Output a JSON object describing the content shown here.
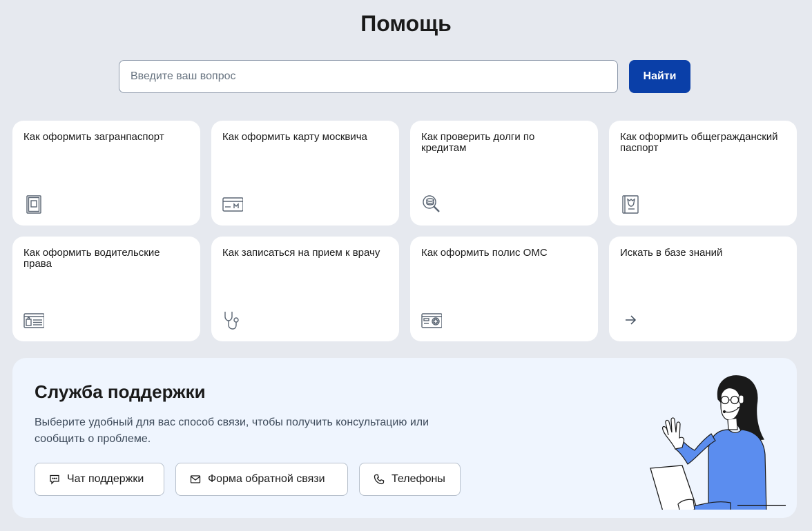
{
  "header": {
    "title": "Помощь"
  },
  "search": {
    "placeholder": "Введите ваш вопрос",
    "button_label": "Найти"
  },
  "cards": [
    {
      "title": "Как оформить загранпаспорт",
      "icon": "passport-icon"
    },
    {
      "title": "Как оформить карту москвича",
      "icon": "card-icon"
    },
    {
      "title": "Как проверить долги по кредитам",
      "icon": "magnifier-coin-icon"
    },
    {
      "title": "Как оформить общегражданский паспорт",
      "icon": "national-passport-icon"
    },
    {
      "title": "Как оформить водительские права",
      "icon": "driver-license-icon"
    },
    {
      "title": "Как записаться на прием к врачу",
      "icon": "stethoscope-icon"
    },
    {
      "title": "Как оформить полис ОМС",
      "icon": "medical-card-icon"
    },
    {
      "title": "Искать в базе знаний",
      "icon": "arrow-right-icon"
    }
  ],
  "support": {
    "title": "Служба поддержки",
    "description": "Выберите удобный для вас способ связи, чтобы получить консультацию или сообщить о проблеме.",
    "buttons": [
      {
        "label": "Чат поддержки",
        "icon": "chat-icon"
      },
      {
        "label": "Форма обратной связи",
        "icon": "mail-icon"
      },
      {
        "label": "Телефоны",
        "icon": "phone-icon"
      }
    ]
  },
  "colors": {
    "primary": "#0a3fa8",
    "background": "#e6e9ef",
    "support_bg": "#eff5fe",
    "illustration_accent": "#5b8def"
  }
}
